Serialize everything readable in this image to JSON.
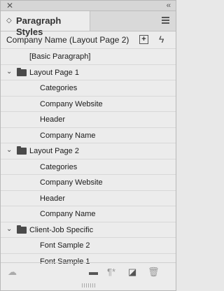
{
  "panel": {
    "close_glyph": "✕",
    "collapse_glyph": "‹‹",
    "tab_label": "Paragraph Styles",
    "tab_arrows": "◇",
    "menu_icon": "hamburger-menu-icon",
    "current_style": "Company Name (Layout Page 2)",
    "new_style_glyph": "+",
    "quick_apply_glyph": "ϟ"
  },
  "list": {
    "basic": "[Basic Paragraph]",
    "groups": [
      {
        "name": "Layout Page 1",
        "chevron": "⌄",
        "items": [
          "Categories",
          "Company Website",
          "Header",
          "Company Name"
        ]
      },
      {
        "name": "Layout Page 2",
        "chevron": "⌄",
        "items": [
          "Categories",
          "Company Website",
          "Header",
          "Company Name"
        ]
      },
      {
        "name": "Client-Job Specific",
        "chevron": "⌄",
        "items": [
          "Font Sample 2",
          "Font Sample 1"
        ]
      }
    ]
  },
  "footer": {
    "cloud_glyph": "☁",
    "folder_glyph": "▬",
    "clear_overrides_glyph": "¶*",
    "new_glyph": "◪",
    "trash_glyph": "🗑"
  }
}
